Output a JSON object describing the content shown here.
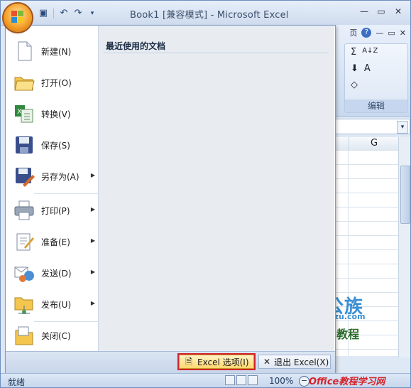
{
  "window": {
    "title": "Book1  [兼容模式] - Microsoft Excel"
  },
  "qat": {
    "icons": [
      "save-icon",
      "undo-icon",
      "redo-icon",
      "customize-icon"
    ]
  },
  "ribbon": {
    "group_label": "编辑",
    "sum_symbol": "Σ",
    "sort_symbol": "A↓Z",
    "find_symbol": "A",
    "clear_symbol": "◇"
  },
  "sheet": {
    "visible_column": "G"
  },
  "office_menu": {
    "recent_docs_title": "最近使用的文档",
    "items": [
      {
        "label": "新建(N)",
        "icon": "new-document-icon",
        "has_submenu": false
      },
      {
        "label": "打开(O)",
        "icon": "open-folder-icon",
        "has_submenu": false
      },
      {
        "label": "转换(V)",
        "icon": "convert-icon",
        "has_submenu": false
      },
      {
        "label": "保存(S)",
        "icon": "save-disk-icon",
        "has_submenu": false
      },
      {
        "label": "另存为(A)",
        "icon": "save-as-icon",
        "has_submenu": true
      },
      {
        "label": "打印(P)",
        "icon": "printer-icon",
        "has_submenu": true
      },
      {
        "label": "准备(E)",
        "icon": "prepare-icon",
        "has_submenu": true
      },
      {
        "label": "发送(D)",
        "icon": "send-icon",
        "has_submenu": true
      },
      {
        "label": "发布(U)",
        "icon": "publish-icon",
        "has_submenu": true
      },
      {
        "label": "关闭(C)",
        "icon": "close-folder-icon",
        "has_submenu": false
      }
    ],
    "options_button": "Excel 选项(I)",
    "exit_button": "退出 Excel(X)"
  },
  "watermark": {
    "brand": "办公族",
    "site": "Officezu.com",
    "tagline": "Excel教程",
    "footer": "Office教程学习网"
  },
  "status": {
    "ready": "就绪",
    "zoom": "100%"
  }
}
